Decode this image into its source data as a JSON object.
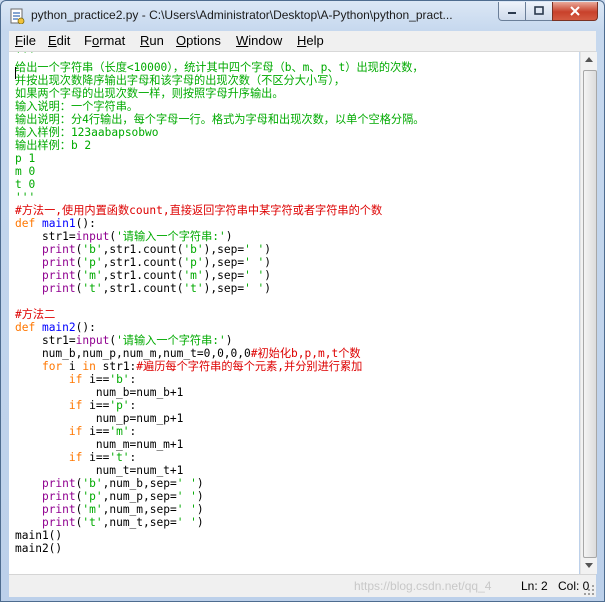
{
  "window": {
    "title": "python_practice2.py - C:\\Users\\Administrator\\Desktop\\A-Python\\python_pract..."
  },
  "menu": [
    {
      "accel": "F",
      "rest": "ile"
    },
    {
      "accel": "E",
      "rest": "dit"
    },
    {
      "accel": "",
      "pre": "F",
      "accelMid": "o",
      "rest": "rmat"
    },
    {
      "accel": "R",
      "rest": "un"
    },
    {
      "accel": "O",
      "rest": "ptions"
    },
    {
      "accel": "W",
      "rest": "indow"
    },
    {
      "accel": "H",
      "rest": "elp"
    }
  ],
  "menu_labels": [
    "File",
    "Edit",
    "Format",
    "Run",
    "Options",
    "Window",
    "Help"
  ],
  "editor": {
    "lines": [
      [
        [
          "s",
          "'''"
        ]
      ],
      [
        [
          "s",
          "给出一个字符串（长度<10000），统计其中四个字母（b、m、p、t）出现的次数，"
        ]
      ],
      [
        [
          "s",
          "并按出现次数降序输出字母和该字母的出现次数（不区分大小写），"
        ]
      ],
      [
        [
          "s",
          "如果两个字母的出现次数一样，则按照字母升序输出。"
        ]
      ],
      [
        [
          "s",
          "输入说明：一个字符串。"
        ]
      ],
      [
        [
          "s",
          "输出说明：分4行输出，每个字母一行。格式为字母和出现次数，以单个空格分隔。"
        ]
      ],
      [
        [
          "s",
          "输入样例：123aabapsobwo"
        ]
      ],
      [
        [
          "s",
          "输出样例：b 2"
        ]
      ],
      [
        [
          "s",
          "p 1"
        ]
      ],
      [
        [
          "s",
          "m 0"
        ]
      ],
      [
        [
          "s",
          "t 0"
        ]
      ],
      [
        [
          "s",
          "'''"
        ]
      ],
      [
        [
          "c",
          "#方法一,使用内置函数count,直接返回字符串中某字符或者字符串的个数"
        ]
      ],
      [
        [
          "k",
          "def "
        ],
        [
          "d",
          "main1"
        ],
        [
          "n",
          "():"
        ]
      ],
      [
        [
          "n",
          "    str1="
        ],
        [
          "b",
          "input"
        ],
        [
          "n",
          "("
        ],
        [
          "s",
          "'请输入一个字符串:'"
        ],
        [
          "n",
          ")"
        ]
      ],
      [
        [
          "n",
          "    "
        ],
        [
          "b",
          "print"
        ],
        [
          "n",
          "("
        ],
        [
          "s",
          "'b'"
        ],
        [
          "n",
          ",str1.count("
        ],
        [
          "s",
          "'b'"
        ],
        [
          "n",
          "),sep="
        ],
        [
          "s",
          "' '"
        ],
        [
          "n",
          ")"
        ]
      ],
      [
        [
          "n",
          "    "
        ],
        [
          "b",
          "print"
        ],
        [
          "n",
          "("
        ],
        [
          "s",
          "'p'"
        ],
        [
          "n",
          ",str1.count("
        ],
        [
          "s",
          "'p'"
        ],
        [
          "n",
          "),sep="
        ],
        [
          "s",
          "' '"
        ],
        [
          "n",
          ")"
        ]
      ],
      [
        [
          "n",
          "    "
        ],
        [
          "b",
          "print"
        ],
        [
          "n",
          "("
        ],
        [
          "s",
          "'m'"
        ],
        [
          "n",
          ",str1.count("
        ],
        [
          "s",
          "'m'"
        ],
        [
          "n",
          "),sep="
        ],
        [
          "s",
          "' '"
        ],
        [
          "n",
          ")"
        ]
      ],
      [
        [
          "n",
          "    "
        ],
        [
          "b",
          "print"
        ],
        [
          "n",
          "("
        ],
        [
          "s",
          "'t'"
        ],
        [
          "n",
          ",str1.count("
        ],
        [
          "s",
          "'t'"
        ],
        [
          "n",
          "),sep="
        ],
        [
          "s",
          "' '"
        ],
        [
          "n",
          ")"
        ]
      ],
      [
        [
          "n",
          ""
        ]
      ],
      [
        [
          "c",
          "#方法二"
        ]
      ],
      [
        [
          "k",
          "def "
        ],
        [
          "d",
          "main2"
        ],
        [
          "n",
          "():"
        ]
      ],
      [
        [
          "n",
          "    str1="
        ],
        [
          "b",
          "input"
        ],
        [
          "n",
          "("
        ],
        [
          "s",
          "'请输入一个字符串:'"
        ],
        [
          "n",
          ")"
        ]
      ],
      [
        [
          "n",
          "    num_b,num_p,num_m,num_t=0,0,0,0"
        ],
        [
          "c",
          "#初始化b,p,m,t个数"
        ]
      ],
      [
        [
          "n",
          "    "
        ],
        [
          "k",
          "for "
        ],
        [
          "n",
          "i "
        ],
        [
          "k",
          "in "
        ],
        [
          "n",
          "str1:"
        ],
        [
          "c",
          "#遍历每个字符串的每个元素,并分别进行累加"
        ]
      ],
      [
        [
          "n",
          "        "
        ],
        [
          "k",
          "if "
        ],
        [
          "n",
          "i=="
        ],
        [
          "s",
          "'b'"
        ],
        [
          "n",
          ":"
        ]
      ],
      [
        [
          "n",
          "            num_b=num_b+1"
        ]
      ],
      [
        [
          "n",
          "        "
        ],
        [
          "k",
          "if "
        ],
        [
          "n",
          "i=="
        ],
        [
          "s",
          "'p'"
        ],
        [
          "n",
          ":"
        ]
      ],
      [
        [
          "n",
          "            num_p=num_p+1"
        ]
      ],
      [
        [
          "n",
          "        "
        ],
        [
          "k",
          "if "
        ],
        [
          "n",
          "i=="
        ],
        [
          "s",
          "'m'"
        ],
        [
          "n",
          ":"
        ]
      ],
      [
        [
          "n",
          "            num_m=num_m+1"
        ]
      ],
      [
        [
          "n",
          "        "
        ],
        [
          "k",
          "if "
        ],
        [
          "n",
          "i=="
        ],
        [
          "s",
          "'t'"
        ],
        [
          "n",
          ":"
        ]
      ],
      [
        [
          "n",
          "            num_t=num_t+1"
        ]
      ],
      [
        [
          "n",
          "    "
        ],
        [
          "b",
          "print"
        ],
        [
          "n",
          "("
        ],
        [
          "s",
          "'b'"
        ],
        [
          "n",
          ",num_b,sep="
        ],
        [
          "s",
          "' '"
        ],
        [
          "n",
          ")"
        ]
      ],
      [
        [
          "n",
          "    "
        ],
        [
          "b",
          "print"
        ],
        [
          "n",
          "("
        ],
        [
          "s",
          "'p'"
        ],
        [
          "n",
          ",num_p,sep="
        ],
        [
          "s",
          "' '"
        ],
        [
          "n",
          ")"
        ]
      ],
      [
        [
          "n",
          "    "
        ],
        [
          "b",
          "print"
        ],
        [
          "n",
          "("
        ],
        [
          "s",
          "'m'"
        ],
        [
          "n",
          ",num_m,sep="
        ],
        [
          "s",
          "' '"
        ],
        [
          "n",
          ")"
        ]
      ],
      [
        [
          "n",
          "    "
        ],
        [
          "b",
          "print"
        ],
        [
          "n",
          "("
        ],
        [
          "s",
          "'t'"
        ],
        [
          "n",
          ",num_t,sep="
        ],
        [
          "s",
          "' '"
        ],
        [
          "n",
          ")"
        ]
      ],
      [
        [
          "n",
          "main1()"
        ]
      ],
      [
        [
          "n",
          "main2()"
        ]
      ]
    ]
  },
  "status": {
    "watermark": "https://blog.csdn.net/qq_4",
    "ln": "Ln: 2",
    "col": "Col: 0"
  },
  "colors": {
    "keyword": "#ff7700",
    "string": "#00aa00",
    "builtin": "#900090",
    "definition": "#0000ff",
    "comment": "#dd0000"
  }
}
